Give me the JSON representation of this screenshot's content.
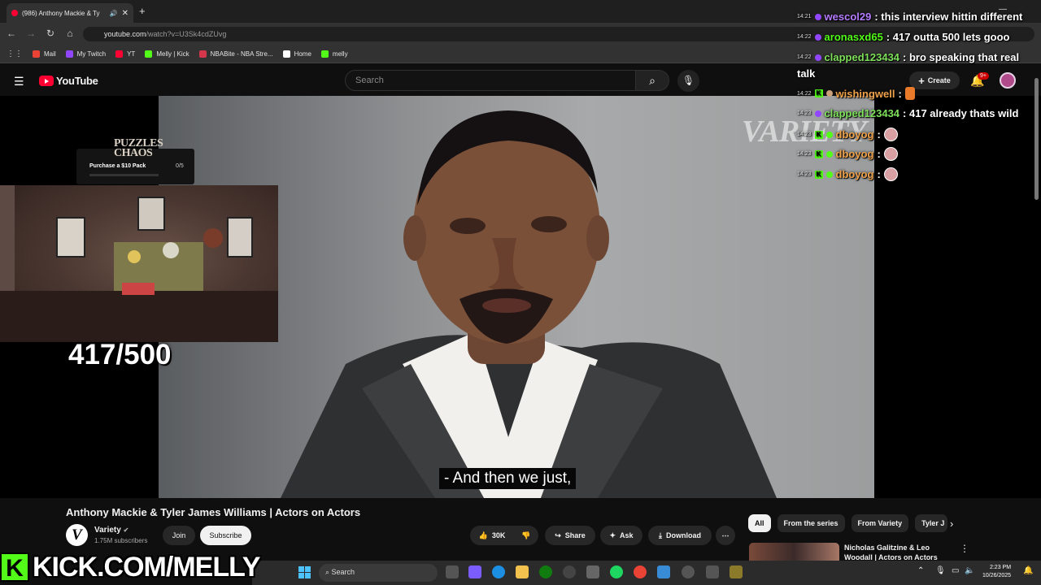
{
  "browser": {
    "tab_title": "(986) Anthony Mackie & Ty",
    "url_host": "youtube.com",
    "url_path": "/watch?v=U3Sk4cdZUvg",
    "bookmarks": [
      {
        "label": "Mail",
        "color": "#ea4335"
      },
      {
        "label": "My Twitch",
        "color": "#9146ff"
      },
      {
        "label": "YT",
        "color": "#ff0033"
      },
      {
        "label": "Melly | Kick",
        "color": "#53fc18"
      },
      {
        "label": "NBABite - NBA Stre...",
        "color": "#d4364b"
      },
      {
        "label": "Home",
        "color": "#ffffff"
      },
      {
        "label": "melly",
        "color": "#53fc18"
      }
    ]
  },
  "youtube": {
    "logo_text": "YouTube",
    "search_placeholder": "Search",
    "create_label": "Create",
    "notif_badge": "9+",
    "caption": "- And then we just,",
    "watermark": "VARIETY",
    "video_title": "Anthony Mackie & Tyler James Williams | Actors on Actors",
    "channel_name": "Variety",
    "subscribers": "1.75M subscribers",
    "join_label": "Join",
    "subscribe_label": "Subscribe",
    "like_count": "30K",
    "share_label": "Share",
    "ask_label": "Ask",
    "download_label": "Download",
    "chips": [
      "All",
      "From the series",
      "From Variety",
      "Tyler J"
    ],
    "rec_title": "Nicholas Galitzine & Leo Woodall | Actors on Actors"
  },
  "overlay": {
    "widget_brand": "PUZZLES CHAOS",
    "widget_action": "Purchase a $10 Pack",
    "widget_progress": "0/5",
    "counter": "417/500",
    "kick_url": "KICK.COM/MELLY"
  },
  "chat": [
    {
      "time": "14:21",
      "user": "wescol29",
      "color": "#b67cff",
      "msg": ": this interview hittin different"
    },
    {
      "time": "14:22",
      "user": "aronasxd65",
      "color": "#53fc18",
      "msg": ": 417 outta 500 lets gooo"
    },
    {
      "time": "14:22",
      "user": "clapped123434",
      "color": "#7ee05a",
      "msg": ": bro speaking that real"
    },
    {
      "time": "",
      "user": "",
      "color": "#ffffff",
      "msg": "talk"
    },
    {
      "time": "14:22",
      "user": "wishingwell",
      "color": "#f0a24a",
      "msg": ":"
    },
    {
      "time": "14:23",
      "user": "clapped123434",
      "color": "#7ee05a",
      "msg": ": 417 already thats wild"
    },
    {
      "time": "14:23",
      "user": "dboyog",
      "color": "#f0a24a",
      "msg": ":"
    },
    {
      "time": "14:23",
      "user": "dboyog",
      "color": "#f0a24a",
      "msg": ":"
    },
    {
      "time": "14:23",
      "user": "dboyog",
      "color": "#f0a24a",
      "msg": ":"
    }
  ],
  "taskbar": {
    "search_label": "Search",
    "time": "2:23 PM",
    "date": "10/26/2025"
  }
}
